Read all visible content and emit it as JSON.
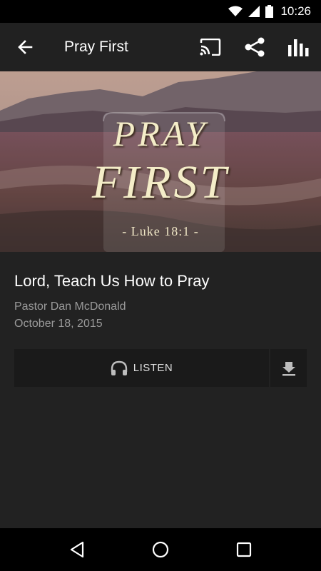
{
  "status_bar": {
    "time": "10:26"
  },
  "app_bar": {
    "title": "Pray First"
  },
  "hero": {
    "title_line1": "PRAY",
    "title_line2": "FIRST",
    "verse": "- Luke 18:1 -"
  },
  "sermon": {
    "title": "Lord, Teach Us How to Pray",
    "speaker": "Pastor Dan McDonald",
    "date": "October 18, 2015"
  },
  "actions": {
    "listen_label": "LISTEN"
  },
  "icons": {
    "back": "arrow-back-icon",
    "cast": "cast-icon",
    "share": "share-icon",
    "stats": "bar-chart-icon",
    "headphones": "headphones-icon",
    "download": "download-icon"
  }
}
